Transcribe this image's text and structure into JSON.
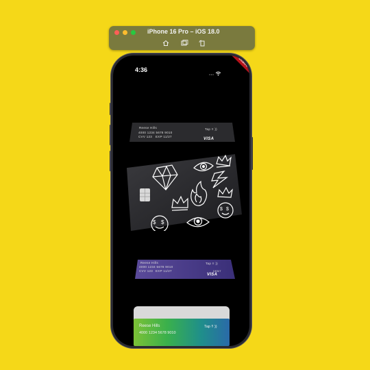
{
  "simulator": {
    "title": "iPhone 16 Pro – iOS 18.0",
    "buttons": [
      "home-icon",
      "screenshot-icon",
      "rotate-icon"
    ]
  },
  "status_bar": {
    "time": "4:36",
    "banner": "DEBUG"
  },
  "cards": {
    "top": {
      "name": "Reese Hills",
      "tap": "Tap !! ))",
      "number": "4000 1234 5678 9010",
      "cvv": "CVV 123",
      "exp": "EXP 11/27",
      "brand": "VISA"
    },
    "middle": {
      "stickers": [
        "diamond-icon",
        "eye-icon",
        "crown-icon",
        "lightning-icon",
        "flame-icon",
        "crown-icon",
        "money-eyes-face-icon",
        "eye-icon",
        "money-eyes-face-icon",
        "chip-icon"
      ]
    },
    "purple": {
      "name": "Reese Hills",
      "tap": "Tap !! ))",
      "number": "4000 1234 5678 9010",
      "cvv": "CVV 123",
      "exp": "EXP 11/27",
      "debit": "DEBIT",
      "brand": "VISA"
    },
    "green": {
      "name": "Reese Hills",
      "tap": "Tap !! ))",
      "number": "4000 1234 5678 9010"
    }
  },
  "colors": {
    "background": "#f5d818",
    "purple_card": "#4a3a8a",
    "green_card": "#3fb34a"
  }
}
